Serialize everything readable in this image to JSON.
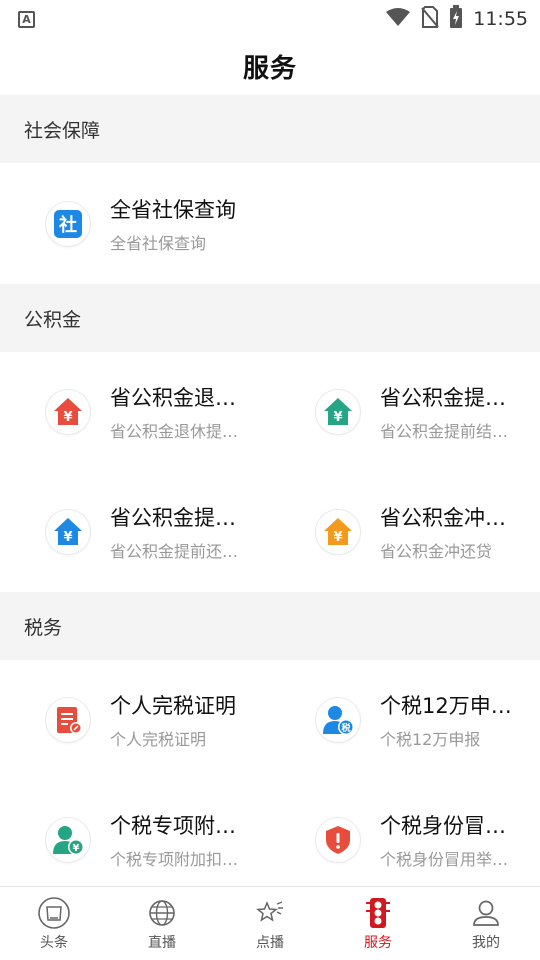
{
  "status_bar": {
    "time": "11:55",
    "app_icon_letter": "A"
  },
  "header": {
    "title": "服务"
  },
  "sections": [
    {
      "title": "社会保障",
      "items": [
        {
          "title": "全省社保查询",
          "subtitle": "全省社保查询",
          "icon": "social-security-icon",
          "color": "#1e88e5",
          "glyph": "社"
        }
      ]
    },
    {
      "title": "公积金",
      "items": [
        {
          "title": "省公积金退…",
          "subtitle": "省公积金退休提…",
          "icon": "housing-fund-red-icon",
          "color": "#e84c3d",
          "glyph": "¥"
        },
        {
          "title": "省公积金提…",
          "subtitle": "省公积金提前结…",
          "icon": "housing-fund-green-icon",
          "color": "#26a584",
          "glyph": "¥"
        },
        {
          "title": "省公积金提…",
          "subtitle": "省公积金提前还…",
          "icon": "housing-fund-blue-icon",
          "color": "#1e88e5",
          "glyph": "¥"
        },
        {
          "title": "省公积金冲…",
          "subtitle": "省公积金冲还贷",
          "icon": "housing-fund-orange-icon",
          "color": "#f39a1e",
          "glyph": "¥"
        }
      ]
    },
    {
      "title": "税务",
      "items": [
        {
          "title": "个人完税证明",
          "subtitle": "个人完税证明",
          "icon": "tax-certificate-icon",
          "color": "#e84c3d",
          "glyph": ""
        },
        {
          "title": "个税12万申…",
          "subtitle": "个税12万申报",
          "icon": "tax-declaration-icon",
          "color": "#1e88e5",
          "glyph": "税"
        },
        {
          "title": "个税专项附…",
          "subtitle": "个税专项附加扣…",
          "icon": "tax-deduction-icon",
          "color": "#26a584",
          "glyph": "¥"
        },
        {
          "title": "个税身份冒…",
          "subtitle": "个税身份冒用举…",
          "icon": "identity-fraud-icon",
          "color": "#e84c3d",
          "glyph": "!"
        }
      ]
    }
  ],
  "tabs": [
    {
      "label": "头条",
      "icon": "headline-icon",
      "active": false
    },
    {
      "label": "直播",
      "icon": "live-globe-icon",
      "active": false
    },
    {
      "label": "点播",
      "icon": "vod-star-icon",
      "active": false
    },
    {
      "label": "服务",
      "icon": "service-traffic-light-icon",
      "active": true
    },
    {
      "label": "我的",
      "icon": "profile-icon",
      "active": false
    }
  ],
  "colors": {
    "accent": "#d0181e",
    "section_bg": "#f4f4f4"
  }
}
